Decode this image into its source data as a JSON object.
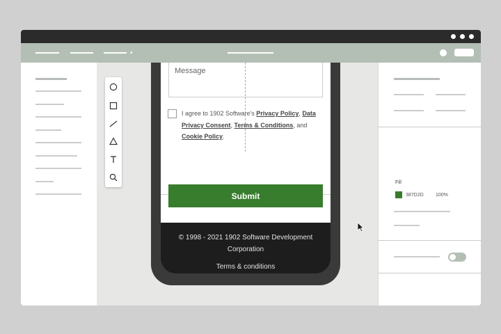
{
  "form": {
    "message_placeholder": "Message",
    "consent": {
      "prefix": "I agree to 1902 Software's ",
      "privacy_policy": "Privacy Policy",
      "sep1": ", ",
      "data_privacy_consent": "Data Privacy Consent",
      "sep2": ", ",
      "terms": "Terms & Conditions",
      "sep3": ", and ",
      "cookie_policy": "Cookie Policy",
      "suffix": "."
    },
    "submit_label": "Submit"
  },
  "footer": {
    "copyright": "© 1998 - 2021 1902 Software Development Corporation",
    "terms_link": "Terms & conditions"
  },
  "properties": {
    "fill_label": "Fill",
    "fill_hex": "387D2D",
    "fill_opacity": "100%",
    "toggle_on": false
  },
  "colors": {
    "accent_green": "#387d2d",
    "toolbar": "#b3bfb4",
    "titlebar": "#2b2b2b",
    "footer_bg": "#1d1d1d"
  },
  "tools": [
    "circle-icon",
    "square-icon",
    "line-icon",
    "triangle-icon",
    "text-icon",
    "zoom-icon"
  ]
}
